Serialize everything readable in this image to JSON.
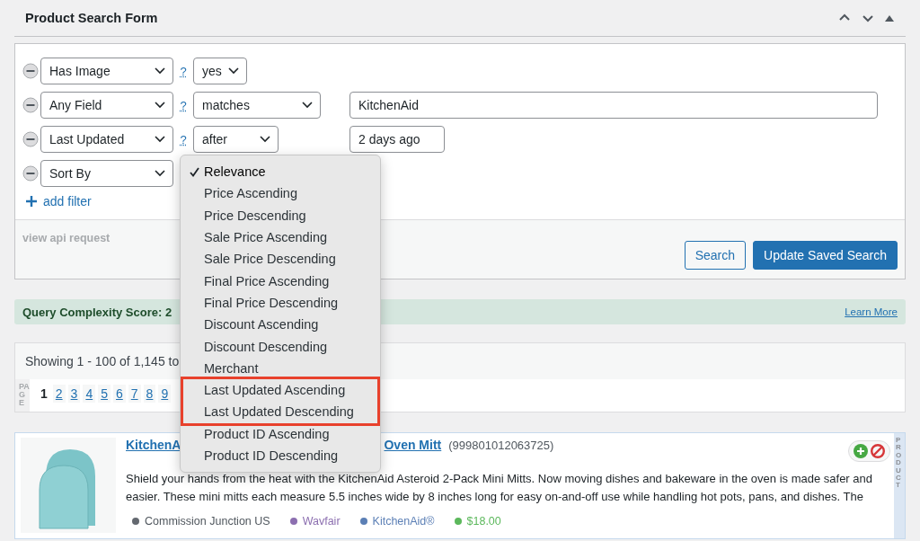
{
  "panel": {
    "title": "Product Search Form"
  },
  "filters": [
    {
      "field": "Has Image",
      "help": "?",
      "operator": "yes"
    },
    {
      "field": "Any Field",
      "help": "?",
      "operator": "matches",
      "value": "KitchenAid"
    },
    {
      "field": "Last Updated",
      "help": "?",
      "operator": "after",
      "value": "2 days ago"
    },
    {
      "field": "Sort By"
    }
  ],
  "add_filter": "add filter",
  "api_link": "view api request",
  "buttons": [
    {
      "label": "Search",
      "kind": "secondary"
    },
    {
      "label": "Update Saved Search",
      "kind": "primary"
    }
  ],
  "notice": {
    "text": "Query Complexity Score: 2",
    "link": "Learn More"
  },
  "results": {
    "summary": "Showing 1 - 100 of 1,145 to",
    "page_label": "PAGE",
    "pages": [
      {
        "label": "1",
        "selected": true
      },
      {
        "label": "2",
        "selected": false
      },
      {
        "label": "3",
        "selected": false
      },
      {
        "label": "4",
        "selected": false
      },
      {
        "label": "5",
        "selected": false
      },
      {
        "label": "6",
        "selected": false
      },
      {
        "label": "7",
        "selected": false
      },
      {
        "label": "8",
        "selected": false
      },
      {
        "label": "9",
        "selected": false
      }
    ]
  },
  "product": {
    "title_start": "KitchenA",
    "title_end": "Oven Mitt",
    "id": "(999801012063725)",
    "side_label": "PRODUCT",
    "description": "Shield your hands from the heat with the KitchenAid Asteroid 2-Pack Mini Mitts. Now moving dishes and bakeware in the oven is made safer and easier. These mini mitts each measure 5.5 inches wide by 8 inches long for easy on-and-off use while handling hot pots, pans, and dishes. The",
    "tags": [
      {
        "text": "Commission Junction US",
        "color": "#646970"
      },
      {
        "text": "Wavfair",
        "color": "#8c6fb0"
      },
      {
        "text": "KitchenAid®",
        "color": "#5b7fb5"
      },
      {
        "text": "$18.00",
        "color": "#5cb85c"
      }
    ]
  },
  "sort_menu": {
    "options": [
      {
        "label": "Relevance",
        "selected": true,
        "highlighted": false
      },
      {
        "label": "Price Ascending",
        "selected": false,
        "highlighted": false
      },
      {
        "label": "Price Descending",
        "selected": false,
        "highlighted": false
      },
      {
        "label": "Sale Price Ascending",
        "selected": false,
        "highlighted": false
      },
      {
        "label": "Sale Price Descending",
        "selected": false,
        "highlighted": false
      },
      {
        "label": "Final Price Ascending",
        "selected": false,
        "highlighted": false
      },
      {
        "label": "Final Price Descending",
        "selected": false,
        "highlighted": false
      },
      {
        "label": "Discount Ascending",
        "selected": false,
        "highlighted": false
      },
      {
        "label": "Discount Descending",
        "selected": false,
        "highlighted": false
      },
      {
        "label": "Merchant",
        "selected": false,
        "highlighted": false
      },
      {
        "label": "Last Updated Ascending",
        "selected": false,
        "highlighted": true
      },
      {
        "label": "Last Updated Descending",
        "selected": false,
        "highlighted": true
      },
      {
        "label": "Product ID Ascending",
        "selected": false,
        "highlighted": false
      },
      {
        "label": "Product ID Descending",
        "selected": false,
        "highlighted": false
      }
    ]
  }
}
